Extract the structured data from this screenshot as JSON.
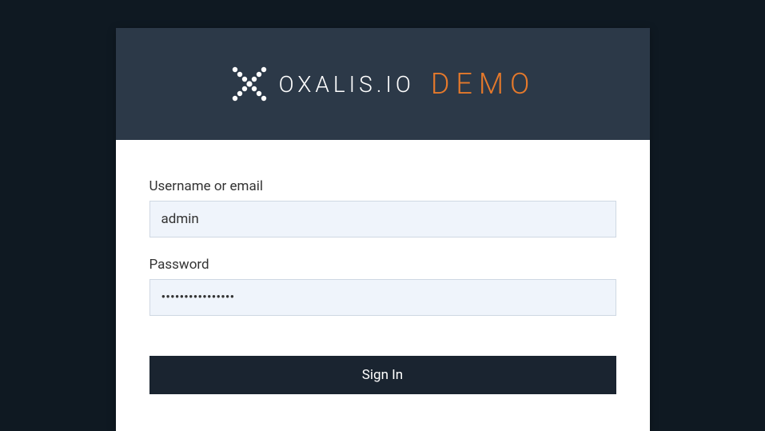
{
  "brand": {
    "name": "OXALIS.IO",
    "suffix": "DEMO"
  },
  "form": {
    "username": {
      "label": "Username or email",
      "value": "admin"
    },
    "password": {
      "label": "Password",
      "value": "••••••••••••••••"
    },
    "submit_label": "Sign In"
  },
  "colors": {
    "page_bg": "#0f1922",
    "header_bg": "#2c3948",
    "accent": "#e5792b",
    "input_bg": "#eff4fb",
    "button_bg": "#1a2430"
  }
}
